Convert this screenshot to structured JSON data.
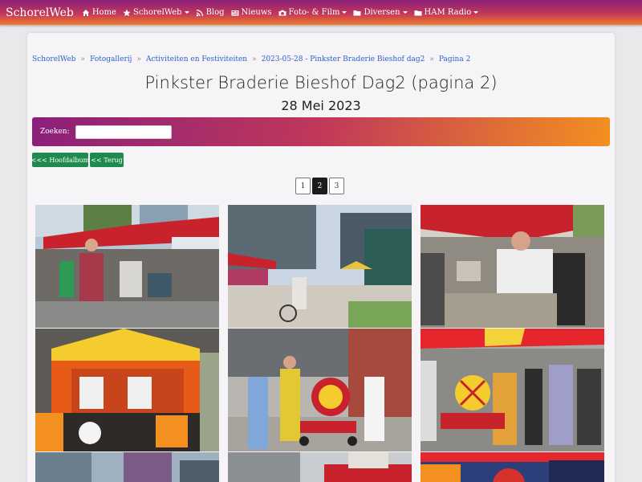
{
  "nav": {
    "brand": "SchorelWeb",
    "items": [
      {
        "label": "Home",
        "icon": "home-icon",
        "dropdown": false
      },
      {
        "label": "SchorelWeb",
        "icon": "star-icon",
        "dropdown": true
      },
      {
        "label": "Blog",
        "icon": "rss-icon",
        "dropdown": false
      },
      {
        "label": "Nieuws",
        "icon": "newspaper-icon",
        "dropdown": false
      },
      {
        "label": "Foto- & Film",
        "icon": "camera-icon",
        "dropdown": true
      },
      {
        "label": "Diversen",
        "icon": "folder-icon",
        "dropdown": true
      },
      {
        "label": "HAM Radio",
        "icon": "folder-icon",
        "dropdown": true
      }
    ]
  },
  "breadcrumb": [
    "SchorelWeb",
    "Fotogallerij",
    "Activiteiten en Festiviteiten",
    "2023-05-28 - Pinkster Braderie Bieshof dag2",
    "Pagina 2"
  ],
  "breadcrumb_separator": "»",
  "page": {
    "title": "Pinkster Braderie Bieshof Dag2 (pagina 2)",
    "subtitle": "28 Mei 2023"
  },
  "search": {
    "label": "Zoeken:",
    "value": ""
  },
  "buttons": {
    "home": "<<< Hoofdalbum",
    "back": "<< Terug"
  },
  "pagination": {
    "pages": [
      "1",
      "2",
      "3"
    ],
    "current": "2"
  },
  "colors": {
    "accent_start": "#8a1f7a",
    "accent_end": "#f39020",
    "button_green": "#1e8a4f",
    "link": "#2a63c9"
  }
}
